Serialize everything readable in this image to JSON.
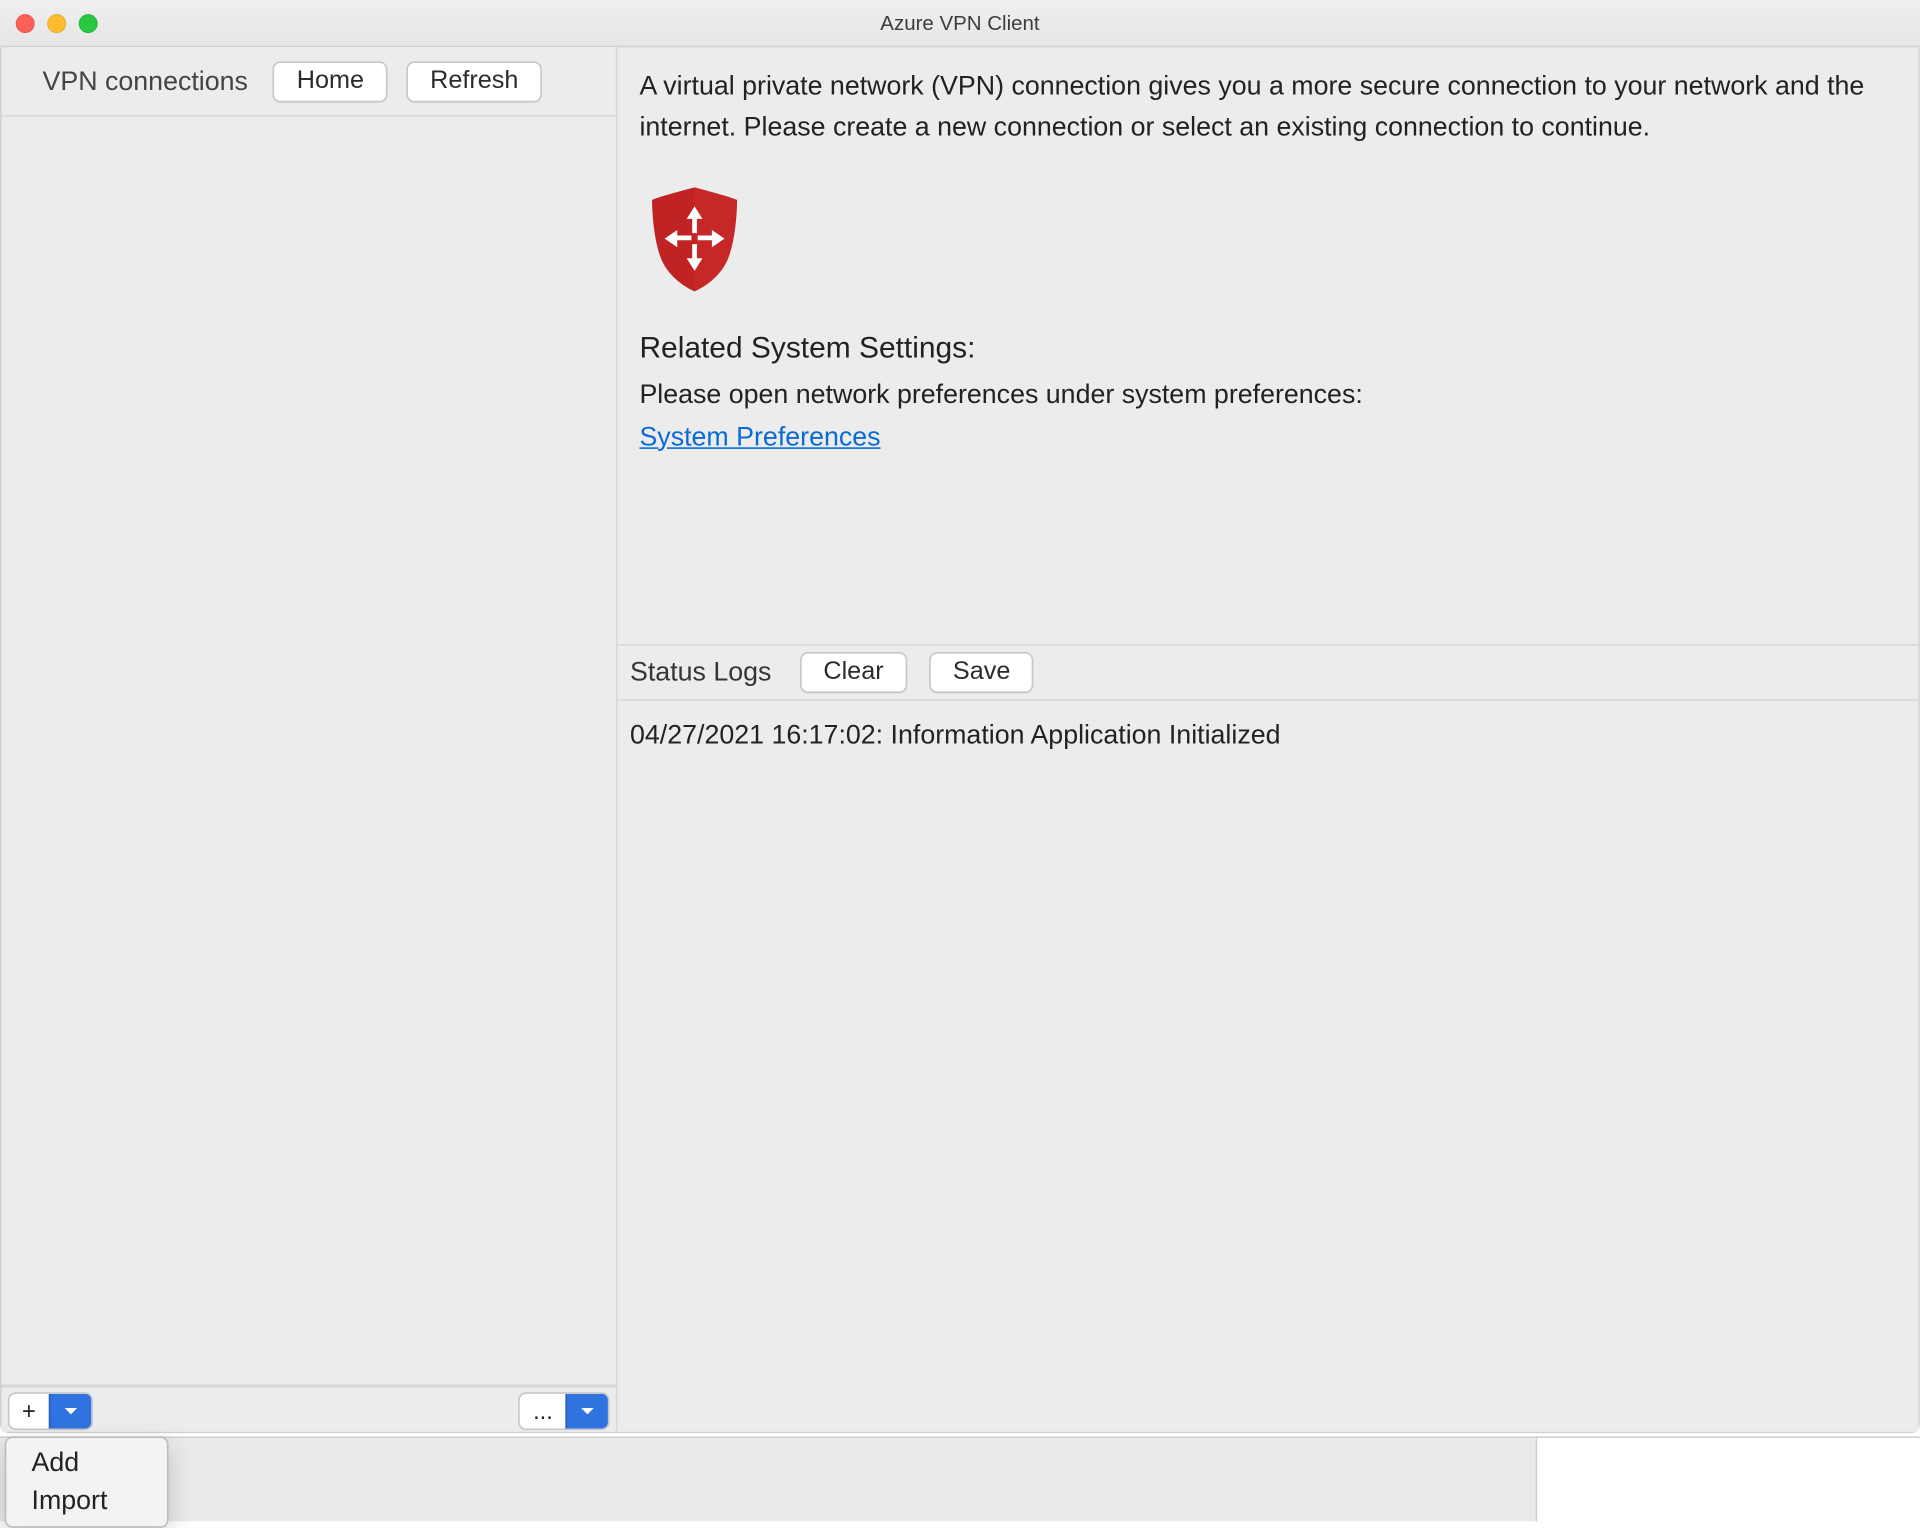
{
  "window": {
    "title": "Azure VPN Client"
  },
  "sidebar": {
    "heading": "VPN connections",
    "home_label": "Home",
    "refresh_label": "Refresh",
    "add_button": "+",
    "more_button": "..."
  },
  "content": {
    "intro": "A virtual private network (VPN) connection gives you a more secure connection to your network and the internet. Please create a new connection or select an existing connection to continue.",
    "related_heading": "Related System Settings:",
    "related_sub": "Please open network preferences under system preferences:",
    "system_prefs_link": "System Preferences"
  },
  "logs": {
    "heading": "Status Logs",
    "clear_label": "Clear",
    "save_label": "Save",
    "entries": [
      "04/27/2021 16:17:02: Information Application Initialized"
    ]
  },
  "popup": {
    "add_label": "Add",
    "import_label": "Import"
  }
}
